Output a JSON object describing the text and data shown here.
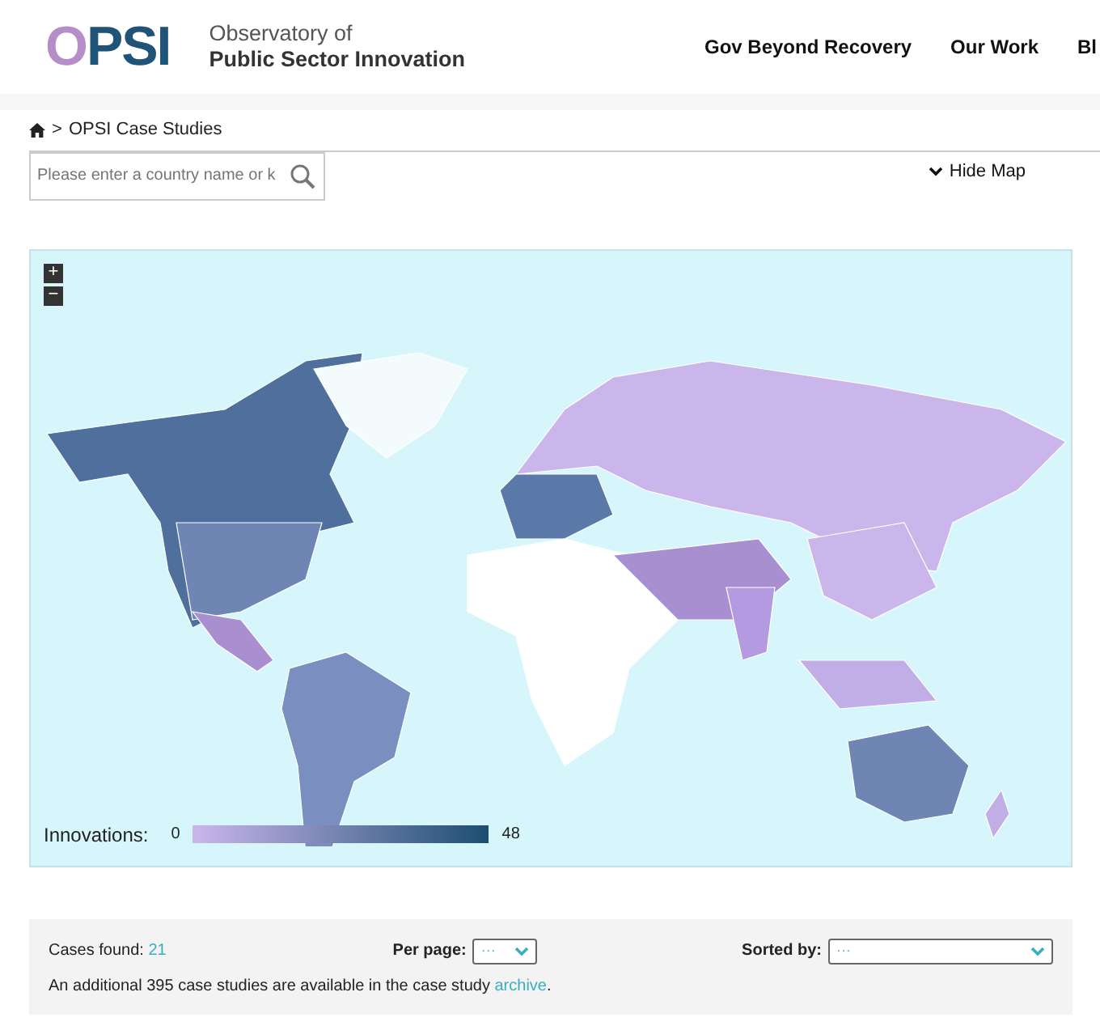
{
  "header": {
    "logo": "OPSI",
    "tagline": [
      "Observatory of",
      "Public Sector Innovation"
    ],
    "nav": [
      {
        "label": "Gov Beyond Recovery"
      },
      {
        "label": "Our Work"
      },
      {
        "label": "Bl"
      }
    ]
  },
  "breadcrumb": {
    "separator": ">",
    "current": "OPSI Case Studies"
  },
  "search": {
    "placeholder": "Please enter a country name or k"
  },
  "map_toggle": {
    "label": "Hide Map",
    "expanded": true
  },
  "map": {
    "zoom_in": "+",
    "zoom_out": "−",
    "legend": {
      "label": "Innovations:",
      "min": "0",
      "max": "48"
    }
  },
  "results": {
    "cases_label": "Cases found:",
    "cases_value": "21",
    "per_page_label": "Per page:",
    "per_page_value": "···",
    "sort_label": "Sorted by:",
    "sort_value": "···",
    "notice": {
      "before": "An additional 395 case studies are available in the case study ",
      "link": "archive",
      "after": "."
    }
  }
}
